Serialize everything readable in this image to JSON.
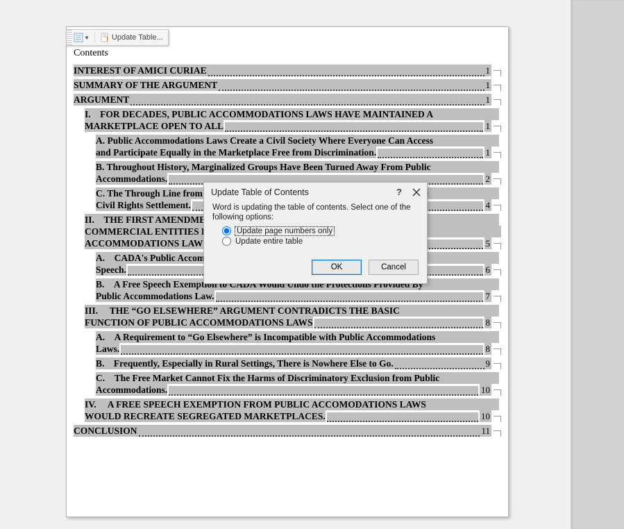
{
  "toolbar": {
    "update_table_label": "Update Table..."
  },
  "doc": {
    "contents_heading": "Contents"
  },
  "toc": [
    {
      "id": "interest",
      "level": 0,
      "wrap": false,
      "title": "INTEREST OF AMICI CURIAE",
      "page": "1"
    },
    {
      "id": "summary",
      "level": 0,
      "wrap": false,
      "title": "SUMMARY OF THE ARGUMENT",
      "page": "1"
    },
    {
      "id": "argument",
      "level": 0,
      "wrap": false,
      "title": "ARGUMENT",
      "page": "1"
    },
    {
      "id": "I",
      "level": 1,
      "wrap": true,
      "first": "I. FOR DECADES, PUBLIC ACCOMMODATIONS LAWS HAVE MAINTAINED A",
      "last": "MARKETPLACE OPEN TO ALL",
      "page": "1"
    },
    {
      "id": "I.A",
      "level": 2,
      "wrap": true,
      "first": "A. Public Accommodations Laws Create a Civil Society Where Everyone Can Access",
      "last": "and Participate Equally in the Marketplace Free from Discrimination.",
      "page": "1"
    },
    {
      "id": "I.B",
      "level": 2,
      "wrap": true,
      "first": "B. Throughout History, Marginalized Groups Have Been Turned Away From Public",
      "last": "Accommodations.",
      "page": "2"
    },
    {
      "id": "I.C",
      "level": 2,
      "wrap": true,
      "first": "C. The Through Line from Early Public Accommodation Precedents Reinforces the",
      "last": "Civil Rights Settlement.",
      "page": "4"
    },
    {
      "id": "II",
      "level": 1,
      "wrap": true,
      "first": "II. THE FIRST AMENDMENT'S FREE SPEECH CLAUSE DOES NOT EXEMPT",
      "mid": "COMMERCIAL ENTITIES FROM COMPLYING WITH PUBLIC",
      "last": "ACCOMMODATIONS LAWS.",
      "page": "5"
    },
    {
      "id": "II.A",
      "level": 2,
      "wrap": true,
      "first": "A. CADA's Public Accommodations Clause Regulates Commercial Conduct, Not",
      "last": "Speech.",
      "page": "6"
    },
    {
      "id": "II.B",
      "level": 2,
      "wrap": true,
      "first": "B. A Free Speech Exemption to CADA Would Undo the Protections Provided By",
      "last": "Public Accommodations Law.",
      "page": "7"
    },
    {
      "id": "III",
      "level": 1,
      "wrap": true,
      "first": "III.  THE “GO ELSEWHERE” ARGUMENT CONTRADICTS THE BASIC",
      "last": "FUNCTION OF PUBLIC ACCOMMODATIONS LAWS",
      "page": "8"
    },
    {
      "id": "III.A",
      "level": 2,
      "wrap": true,
      "first": "A. A Requirement to “Go Elsewhere” is Incompatible with Public Accommodations",
      "last": "Laws.",
      "page": "8"
    },
    {
      "id": "III.B",
      "level": 2,
      "wrap": false,
      "title": "B. Frequently, Especially in Rural Settings, There is Nowhere Else to Go.",
      "page": "9"
    },
    {
      "id": "III.C",
      "level": 2,
      "wrap": true,
      "first": "C. The Free Market Cannot Fix the Harms of Discriminatory Exclusion from Public",
      "last": "Accommodations.",
      "page": "10"
    },
    {
      "id": "IV",
      "level": 1,
      "wrap": true,
      "first": "IV.  A FREE SPEECH EXEMPTION FROM PUBLIC ACCOMODATIONS LAWS",
      "last": "WOULD RECREATE SEGREGATED MARKETPLACES.",
      "page": "10"
    },
    {
      "id": "conclusion",
      "level": 0,
      "wrap": false,
      "title": "CONCLUSION",
      "page": "11"
    }
  ],
  "dialog": {
    "title": "Update Table of Contents",
    "help_char": "?",
    "message": "Word is updating the table of contents.  Select one of the following options:",
    "option_page_numbers": "Update page numbers only",
    "option_entire_table": "Update entire table",
    "selected": "page_numbers",
    "ok_label": "OK",
    "cancel_label": "Cancel"
  }
}
